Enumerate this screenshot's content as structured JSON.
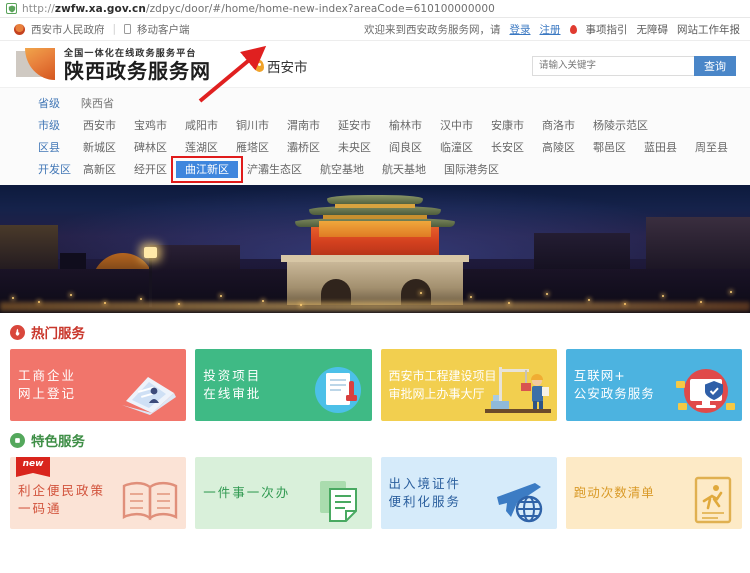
{
  "browser": {
    "url_prefix": "http://",
    "url_domain": "zwfw.xa.gov.cn",
    "url_path": "/zdpyc/door/#/home/home-new-index?areaCode=610100000000",
    "shield_icon": "secure-shield-icon"
  },
  "topbar": {
    "gov_link": "西安市人民政府",
    "separator": "|",
    "mobile_link": "移动客户端",
    "welcome": "欢迎来到西安政务服务网，请",
    "login": "登录",
    "register": "注册",
    "guide": "事项指引",
    "accessibility": "无障碍",
    "annual_report": "网站工作年报"
  },
  "header": {
    "logo_top": "全国一体化在线政务服务平台",
    "logo_main": "陕西政务服务网",
    "city": "西安市",
    "search_placeholder": "请输入关键字",
    "search_button": "查询"
  },
  "regions": {
    "province": {
      "label": "省级",
      "items": [
        "陕西省"
      ]
    },
    "city": {
      "label": "市级",
      "items": [
        "西安市",
        "宝鸡市",
        "咸阳市",
        "铜川市",
        "渭南市",
        "延安市",
        "榆林市",
        "汉中市",
        "安康市",
        "商洛市",
        "杨陵示范区"
      ]
    },
    "district": {
      "label": "区县",
      "items": [
        "新城区",
        "碑林区",
        "莲湖区",
        "雁塔区",
        "灞桥区",
        "未央区",
        "阎良区",
        "临潼区",
        "长安区",
        "高陵区",
        "鄠邑区",
        "蓝田县",
        "周至县"
      ]
    },
    "devzone": {
      "label": "开发区",
      "items": [
        "高新区",
        "经开区",
        "曲江新区",
        "浐灞生态区",
        "航空基地",
        "航天基地",
        "国际港务区"
      ],
      "selected": "曲江新区"
    }
  },
  "hero": {
    "alt": "西安钟楼夜景"
  },
  "hot_services": {
    "icon": "flame-icon",
    "title": "热门服务",
    "cards": [
      {
        "text": "工商企业\n网上登记",
        "color": "#f1756b",
        "art": "laptop-person-icon"
      },
      {
        "text": "投资项目\n在线审批",
        "color": "#3fba85",
        "art": "document-stamp-icon"
      },
      {
        "text": "西安市工程建设项目\n审批网上办事大厅",
        "color": "#f2cf4f",
        "art": "construction-worker-icon"
      },
      {
        "text": "互联网+\n公安政务服务",
        "color": "#4cb3e0",
        "art": "monitor-shield-icon"
      }
    ]
  },
  "featured_services": {
    "icon": "badge-icon",
    "title": "特色服务",
    "cards": [
      {
        "text": "利企便民政策\n一码通",
        "color": "#fbe3d6",
        "badge": "new",
        "art": "open-book-icon"
      },
      {
        "text": "一件事一次办",
        "color": "#d9f0da",
        "art": "documents-icon"
      },
      {
        "text": "出入境证件\n便利化服务",
        "color": "#d6ebfa",
        "art": "airplane-globe-icon"
      },
      {
        "text": "跑动次数清单",
        "color": "#fdeac6",
        "art": "running-person-icon"
      }
    ]
  }
}
